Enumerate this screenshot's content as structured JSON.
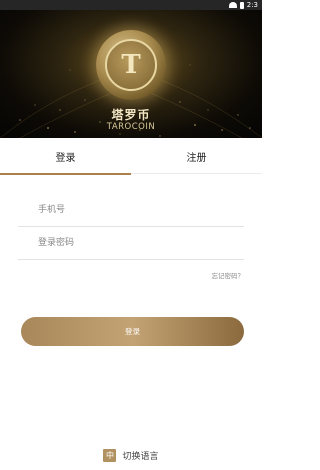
{
  "status_bar": {
    "time": "2:3"
  },
  "header": {
    "coin_symbol": "T",
    "brand_cn": "塔罗币",
    "brand_en": "TAROCOIN"
  },
  "tabs": {
    "login": "登录",
    "register": "注册"
  },
  "form": {
    "phone_placeholder": "手机号",
    "password_placeholder": "登录密码",
    "forgot_password": "忘记密码？",
    "submit_label": "登录"
  },
  "footer": {
    "lang_icon": "中",
    "switch_language": "切换语言"
  },
  "colors": {
    "accent": "#a8804a",
    "button_gradient_start": "#a8875a",
    "button_gradient_end": "#8b6a3e",
    "header_background": "#0e0b06"
  },
  "icons": {
    "wifi": "wifi-icon",
    "battery": "battery-icon",
    "coin": "coin-logo",
    "language": "language-icon"
  }
}
